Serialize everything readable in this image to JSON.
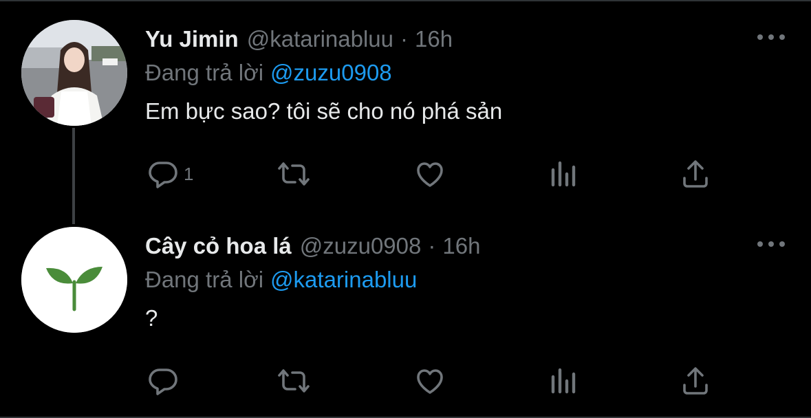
{
  "tweets": [
    {
      "name": "Yu Jimin",
      "handle": "@katarinabluu",
      "separator": "·",
      "time": "16h",
      "reply_prefix": "Đang trả lời",
      "reply_mention": "@zuzu0908",
      "text": "Em bực sao? tôi sẽ cho nó phá sản",
      "reply_count": "1",
      "avatar": "photo-avatar"
    },
    {
      "name": "Cây cỏ hoa lá",
      "handle": "@zuzu0908",
      "separator": "·",
      "time": "16h",
      "reply_prefix": "Đang trả lời",
      "reply_mention": "@katarinabluu",
      "text": "?",
      "reply_count": "",
      "avatar": "sprout-avatar"
    }
  ],
  "icons": [
    "reply-icon",
    "retweet-icon",
    "like-icon",
    "views-icon",
    "share-icon",
    "more-icon"
  ],
  "colors": {
    "background": "#000000",
    "text": "#e7e9ea",
    "muted": "#71767b",
    "accent": "#1d9bf0",
    "sprout": "#4a8c3a"
  }
}
